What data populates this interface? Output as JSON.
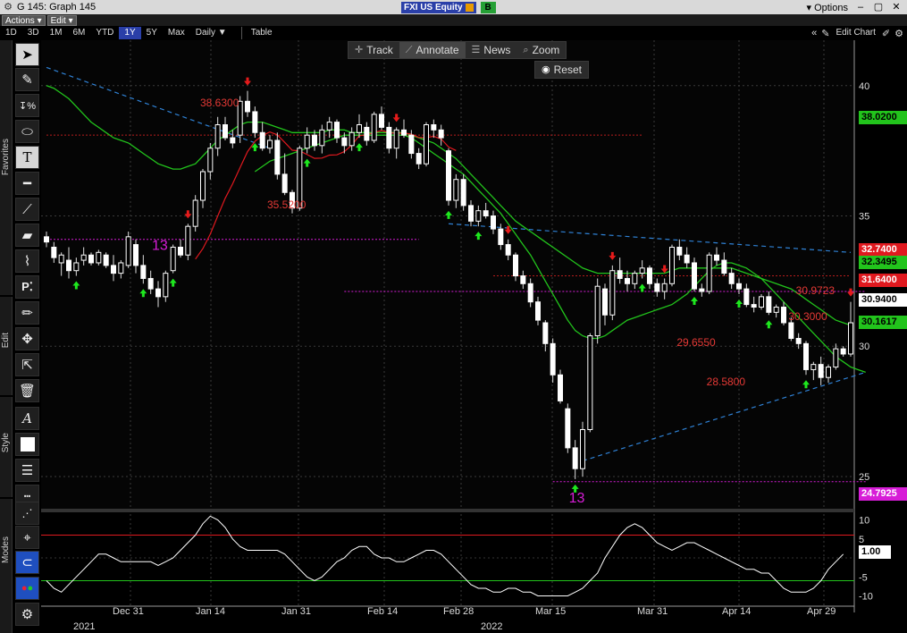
{
  "window": {
    "title": "G 145: Graph 145",
    "ticker": "FXI US Equity",
    "badge": "B",
    "options_label": "Options"
  },
  "menubar": {
    "actions": "Actions ▾",
    "edit": "Edit ▾"
  },
  "toolbar": {
    "timeframes": [
      "1D",
      "3D",
      "1M",
      "6M",
      "YTD",
      "1Y",
      "5Y",
      "Max"
    ],
    "active": "1Y",
    "period": "Daily ▼",
    "table": "Table",
    "edit_chart": "Edit Chart"
  },
  "overlay": {
    "track": "Track",
    "annotate": "Annotate",
    "news": "News",
    "zoom": "Zoom",
    "reset": "Reset"
  },
  "sidebar": {
    "favorites": "Favorites",
    "edit": "Edit",
    "style": "Style",
    "modes": "Modes"
  },
  "tools": {
    "pointer": "pointer-icon",
    "line": "line-draw-icon",
    "percent": "percent-icon",
    "ellipse": "ellipse-icon",
    "text": "text-icon",
    "hline": "horizontal-line-icon",
    "trendline": "trendline-icon",
    "channel": "channel-icon",
    "polyline": "polyline-icon",
    "pattern": "pattern-icon",
    "pen": "pen-icon",
    "move": "move-icon",
    "add": "add-point-icon",
    "trash": "trash-icon",
    "font": "font-icon",
    "fill": "fill-color-icon",
    "linewidth": "line-width-icon",
    "linestyle": "line-style-icon",
    "eraser": "eraser-icon",
    "crosshair": "crosshair-icon",
    "magnet": "magnet-icon",
    "colors": "color-palette-icon",
    "settings": "gear-icon"
  },
  "colors": {
    "candle_up": "#ffffff",
    "ma_green": "#22c41c",
    "ma_red": "#e0191f",
    "trend_blue": "#2f82d6",
    "magenta": "#d71dd7",
    "buy_arrow": "#1ee81e",
    "sell_arrow": "#e51b1b"
  },
  "chart_data": {
    "type": "line",
    "subtype": "candlestick",
    "x_ticks": [
      "Dec 31",
      "Jan 14",
      "Jan 31",
      "Feb 14",
      "Feb 28",
      "Mar 15",
      "Mar 31",
      "Apr 14",
      "Apr 29"
    ],
    "years": [
      "2021",
      "2022"
    ],
    "y_ticks": [
      40,
      35,
      30,
      25
    ],
    "ylim": [
      23.9,
      41.4
    ],
    "candles": [
      [
        34.2,
        34.4,
        33.8,
        34.0
      ],
      [
        33.8,
        34.0,
        33.2,
        33.4
      ],
      [
        33.2,
        33.6,
        32.7,
        33.5
      ],
      [
        33.3,
        33.8,
        32.6,
        32.9
      ],
      [
        32.9,
        33.4,
        32.7,
        33.2
      ],
      [
        33.3,
        33.8,
        33.1,
        33.5
      ],
      [
        33.5,
        33.6,
        33.1,
        33.2
      ],
      [
        33.2,
        33.7,
        33.1,
        33.6
      ],
      [
        33.5,
        33.6,
        33.0,
        33.1
      ],
      [
        33.1,
        33.5,
        32.5,
        32.8
      ],
      [
        32.8,
        33.3,
        32.6,
        33.2
      ],
      [
        33.1,
        34.4,
        33.0,
        34.2
      ],
      [
        33.9,
        34.1,
        32.8,
        33.1
      ],
      [
        33.1,
        33.5,
        32.4,
        32.6
      ],
      [
        32.6,
        32.9,
        32.0,
        32.2
      ],
      [
        32.2,
        32.5,
        31.5,
        31.9
      ],
      [
        31.9,
        32.9,
        31.7,
        32.8
      ],
      [
        32.9,
        33.9,
        32.8,
        33.8
      ],
      [
        33.8,
        34.1,
        33.4,
        33.5
      ],
      [
        33.5,
        34.7,
        33.3,
        34.6
      ],
      [
        34.6,
        35.8,
        34.4,
        35.6
      ],
      [
        35.6,
        36.8,
        35.3,
        36.7
      ],
      [
        36.7,
        37.8,
        36.4,
        37.6
      ],
      [
        37.6,
        38.8,
        37.3,
        38.5
      ],
      [
        38.5,
        38.8,
        37.9,
        38.0
      ],
      [
        38.0,
        38.3,
        37.6,
        37.8
      ],
      [
        38.1,
        39.6,
        37.8,
        39.4
      ],
      [
        39.4,
        39.8,
        38.8,
        39.0
      ],
      [
        39.0,
        39.2,
        38.0,
        38.2
      ],
      [
        38.2,
        38.6,
        37.5,
        37.6
      ],
      [
        37.6,
        38.1,
        37.4,
        37.9
      ],
      [
        37.9,
        38.2,
        36.4,
        36.6
      ],
      [
        36.6,
        37.4,
        35.8,
        35.9
      ],
      [
        35.9,
        36.0,
        35.1,
        35.3
      ],
      [
        35.3,
        37.7,
        35.2,
        37.6
      ],
      [
        37.6,
        38.4,
        37.4,
        38.1
      ],
      [
        38.1,
        38.3,
        37.5,
        37.7
      ],
      [
        37.7,
        38.5,
        37.4,
        38.3
      ],
      [
        38.3,
        38.8,
        38.0,
        38.6
      ],
      [
        38.6,
        38.7,
        37.8,
        38.0
      ],
      [
        38.0,
        38.2,
        37.4,
        37.7
      ],
      [
        37.7,
        38.4,
        37.5,
        38.2
      ],
      [
        38.2,
        38.9,
        38.0,
        38.5
      ],
      [
        38.4,
        38.6,
        37.7,
        37.9
      ],
      [
        37.9,
        39.0,
        37.8,
        38.9
      ],
      [
        38.9,
        39.2,
        38.3,
        38.4
      ],
      [
        38.4,
        38.6,
        37.4,
        37.6
      ],
      [
        37.6,
        38.4,
        37.2,
        38.3
      ],
      [
        38.3,
        38.7,
        38.0,
        38.1
      ],
      [
        38.1,
        38.3,
        37.2,
        37.4
      ],
      [
        37.4,
        37.6,
        36.8,
        37.0
      ],
      [
        37.0,
        38.6,
        36.9,
        38.5
      ],
      [
        38.5,
        38.7,
        38.0,
        38.3
      ],
      [
        38.3,
        38.5,
        37.7,
        38.0
      ],
      [
        37.5,
        37.6,
        35.4,
        35.6
      ],
      [
        35.6,
        36.6,
        35.3,
        36.4
      ],
      [
        36.4,
        36.6,
        35.2,
        35.4
      ],
      [
        35.4,
        35.6,
        34.6,
        34.8
      ],
      [
        34.8,
        35.4,
        34.6,
        35.2
      ],
      [
        35.2,
        35.5,
        34.9,
        35.0
      ],
      [
        35.0,
        35.2,
        34.3,
        34.5
      ],
      [
        34.5,
        34.7,
        33.7,
        33.9
      ],
      [
        33.9,
        34.1,
        33.3,
        33.5
      ],
      [
        33.5,
        33.6,
        32.5,
        32.7
      ],
      [
        32.7,
        32.9,
        32.2,
        32.4
      ],
      [
        32.4,
        32.6,
        31.5,
        31.7
      ],
      [
        31.7,
        31.9,
        30.8,
        31.0
      ],
      [
        30.9,
        31.0,
        29.8,
        30.1
      ],
      [
        30.1,
        30.3,
        28.6,
        28.9
      ],
      [
        28.9,
        29.1,
        27.8,
        27.9
      ],
      [
        27.6,
        27.8,
        25.9,
        26.1
      ],
      [
        26.1,
        26.4,
        24.9,
        25.3
      ],
      [
        25.3,
        27.1,
        25.0,
        26.8
      ],
      [
        26.8,
        30.5,
        26.7,
        30.4
      ],
      [
        30.4,
        32.6,
        30.1,
        32.3
      ],
      [
        32.2,
        32.4,
        30.8,
        31.2
      ],
      [
        31.2,
        33.1,
        31.0,
        32.9
      ],
      [
        32.9,
        33.4,
        32.4,
        32.6
      ],
      [
        32.6,
        32.9,
        32.1,
        32.4
      ],
      [
        32.4,
        32.9,
        32.2,
        32.8
      ],
      [
        32.8,
        33.3,
        32.6,
        33.0
      ],
      [
        33.0,
        33.1,
        32.2,
        32.4
      ],
      [
        32.4,
        32.6,
        31.9,
        32.1
      ],
      [
        32.1,
        32.6,
        31.8,
        32.4
      ],
      [
        32.4,
        33.9,
        32.3,
        33.8
      ],
      [
        33.8,
        34.1,
        33.3,
        33.5
      ],
      [
        33.5,
        33.8,
        33.0,
        33.2
      ],
      [
        33.2,
        33.4,
        32.1,
        32.2
      ],
      [
        32.2,
        32.4,
        31.9,
        32.1
      ],
      [
        32.1,
        33.6,
        32.0,
        33.5
      ],
      [
        33.5,
        33.8,
        33.1,
        33.3
      ],
      [
        33.3,
        33.6,
        32.7,
        32.8
      ],
      [
        32.8,
        33.0,
        32.2,
        32.4
      ],
      [
        32.4,
        32.6,
        32.0,
        32.2
      ],
      [
        32.2,
        32.4,
        31.5,
        31.6
      ],
      [
        31.6,
        31.9,
        31.3,
        31.5
      ],
      [
        31.5,
        32.0,
        31.4,
        31.9
      ],
      [
        31.9,
        32.1,
        31.2,
        31.3
      ],
      [
        31.3,
        31.6,
        31.1,
        31.5
      ],
      [
        31.5,
        31.7,
        30.8,
        30.9
      ],
      [
        30.9,
        31.1,
        30.2,
        30.3
      ],
      [
        30.3,
        30.5,
        29.9,
        30.1
      ],
      [
        30.1,
        30.2,
        28.9,
        29.1
      ],
      [
        29.1,
        29.4,
        28.7,
        29.3
      ],
      [
        29.3,
        29.6,
        28.5,
        28.8
      ],
      [
        28.8,
        29.3,
        28.6,
        29.2
      ],
      [
        29.2,
        30.1,
        29.1,
        29.9
      ],
      [
        29.9,
        30.0,
        29.6,
        29.7
      ],
      [
        29.7,
        31.7,
        29.6,
        30.9
      ]
    ],
    "series": [
      {
        "values": [
          40.0,
          39.9,
          39.7,
          39.5,
          39.2,
          38.9,
          38.6,
          38.4,
          38.2,
          38.0,
          37.9,
          37.8,
          37.6,
          37.4,
          37.2,
          37.0,
          36.9,
          36.8,
          36.8,
          36.9,
          37.0,
          37.3,
          37.6,
          37.9,
          38.1,
          38.3,
          38.5,
          38.6,
          38.6,
          38.6,
          38.5,
          38.4,
          38.3,
          38.2,
          38.2,
          38.2,
          38.2,
          38.2,
          38.3,
          38.3,
          38.3,
          38.2,
          38.2,
          38.2,
          38.2,
          38.2,
          38.2,
          38.2,
          38.2,
          38.1,
          38.0,
          37.9,
          37.8,
          37.6,
          37.4,
          37.2,
          36.9,
          36.6,
          36.3,
          36.0,
          35.7,
          35.4,
          35.1,
          34.8,
          34.6,
          34.4,
          34.2,
          34.0,
          33.8,
          33.6,
          33.4,
          33.2,
          33.0,
          32.9,
          32.8,
          32.8,
          32.8,
          32.8,
          32.8,
          32.8,
          32.8,
          32.8,
          32.8,
          32.8,
          32.9,
          33.0,
          33.0,
          33.0,
          33.0,
          33.0,
          33.0,
          33.0,
          33.0,
          32.9,
          32.8,
          32.7,
          32.6,
          32.5,
          32.4,
          32.3,
          32.2,
          32.0,
          31.8,
          31.6,
          31.4,
          31.2,
          31.0,
          30.9,
          30.8
        ]
      },
      {
        "values": [
          null,
          null,
          null,
          null,
          null,
          null,
          null,
          null,
          null,
          null,
          null,
          null,
          null,
          null,
          null,
          null,
          null,
          null,
          null,
          null,
          null,
          null,
          null,
          null,
          null,
          null,
          null,
          null,
          36.7,
          36.9,
          37.1,
          37.2,
          37.3,
          37.4,
          37.5,
          37.6,
          37.7,
          37.8,
          37.9,
          38.0,
          38.1,
          38.1,
          38.1,
          38.1,
          38.1,
          38.1,
          38.1,
          38.1,
          38.1,
          38.0,
          37.8,
          37.6,
          37.4,
          37.2,
          37.0,
          36.8,
          36.6,
          36.3,
          36.0,
          35.7,
          35.4,
          35.1,
          34.7,
          34.3,
          33.9,
          33.5,
          33.0,
          32.5,
          32.0,
          31.5,
          31.0,
          30.6,
          30.4,
          30.3,
          30.3,
          30.4,
          30.6,
          30.8,
          31.0,
          31.1,
          31.2,
          31.3,
          31.4,
          31.5,
          31.6,
          31.8,
          32.0,
          32.3,
          32.6,
          32.9,
          33.1,
          33.2,
          33.2,
          33.1,
          33.0,
          32.8,
          32.6,
          32.3,
          32.0,
          31.7,
          31.4,
          31.1,
          30.8,
          30.5,
          30.2,
          29.9,
          29.6,
          29.4,
          29.2,
          29.1,
          29.0
        ]
      }
    ],
    "price_tags": [
      "38.0200",
      "32.7400",
      "32.3495",
      "31.6400",
      "30.9400",
      "30.1617",
      "24.7925"
    ],
    "annotations": [
      "38.6300",
      "35.5200",
      "30.9723",
      "30.3000",
      "29.6550",
      "28.5800",
      "13"
    ],
    "oscillator": {
      "ylim": [
        -12,
        12
      ],
      "y_ticks": [
        10,
        5,
        1.0,
        -5,
        -10
      ],
      "levels": {
        "upper": 6,
        "lower": -6
      },
      "values": [
        -6,
        -8,
        -9,
        -7,
        -5,
        -3,
        -1,
        1,
        1,
        0,
        -1,
        -1,
        -1,
        -1,
        -1,
        -2,
        -1,
        0,
        2,
        4,
        6,
        9,
        11,
        10,
        8,
        5,
        3,
        2,
        2,
        2,
        2,
        2,
        1,
        -1,
        -3,
        -5,
        -6,
        -5,
        -3,
        -1,
        0,
        2,
        3,
        3,
        1,
        0,
        0,
        -1,
        -1,
        0,
        1,
        2,
        2,
        1,
        -1,
        -3,
        -5,
        -7,
        -8,
        -8,
        -9,
        -9,
        -8,
        -8,
        -9,
        -9,
        -10,
        -10,
        -10,
        -10,
        -10,
        -9,
        -8,
        -6,
        -4,
        0,
        3,
        6,
        8,
        9,
        8,
        6,
        4,
        3,
        2,
        3,
        4,
        4,
        3,
        2,
        1,
        0,
        -1,
        -2,
        -3,
        -3,
        -4,
        -4,
        -6,
        -8,
        -9,
        -9,
        -9,
        -8,
        -6,
        -3,
        -1,
        1
      ]
    }
  },
  "tag_labels": {
    "t38": "38.0200",
    "t327": "32.7400",
    "t323": "32.3495",
    "t316": "31.6400",
    "t309": "30.9400",
    "t301": "30.1617",
    "t247": "24.7925",
    "osc": "1.00"
  }
}
